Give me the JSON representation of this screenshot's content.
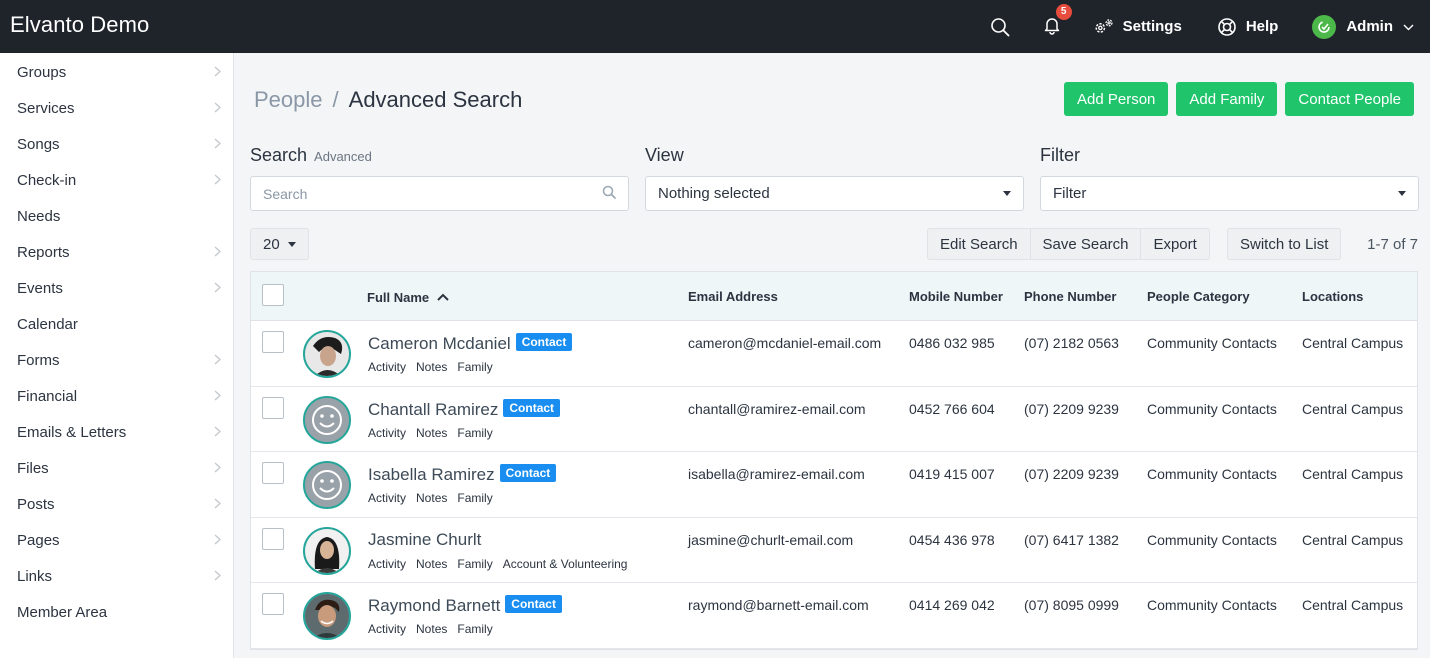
{
  "app": {
    "title": "Elvanto Demo"
  },
  "topbar": {
    "notifications_count": "5",
    "settings_label": "Settings",
    "help_label": "Help",
    "user_label": "Admin"
  },
  "sidebar": {
    "items": [
      {
        "label": "Groups",
        "has_children": true
      },
      {
        "label": "Services",
        "has_children": true
      },
      {
        "label": "Songs",
        "has_children": true
      },
      {
        "label": "Check-in",
        "has_children": true
      },
      {
        "label": "Needs",
        "has_children": false
      },
      {
        "label": "Reports",
        "has_children": true
      },
      {
        "label": "Events",
        "has_children": true
      },
      {
        "label": "Calendar",
        "has_children": false
      },
      {
        "label": "Forms",
        "has_children": true
      },
      {
        "label": "Financial",
        "has_children": true
      },
      {
        "label": "Emails & Letters",
        "has_children": true
      },
      {
        "label": "Files",
        "has_children": true
      },
      {
        "label": "Posts",
        "has_children": true
      },
      {
        "label": "Pages",
        "has_children": true
      },
      {
        "label": "Links",
        "has_children": true
      },
      {
        "label": "Member Area",
        "has_children": false
      }
    ]
  },
  "breadcrumb": {
    "parent": "People",
    "separator": "/",
    "current": "Advanced Search"
  },
  "actions": {
    "add_person": "Add Person",
    "add_family": "Add Family",
    "contact_people": "Contact People"
  },
  "search": {
    "label": "Search",
    "sublabel": "Advanced",
    "placeholder": "Search"
  },
  "view": {
    "label": "View",
    "selected": "Nothing selected"
  },
  "filter": {
    "label": "Filter",
    "selected": "Filter"
  },
  "toolbar": {
    "per_page": "20",
    "edit_search": "Edit Search",
    "save_search": "Save Search",
    "export": "Export",
    "switch_to_list": "Switch to List",
    "count": "1-7 of 7"
  },
  "table": {
    "headers": {
      "full_name": "Full Name",
      "email": "Email Address",
      "mobile": "Mobile Number",
      "phone": "Phone Number",
      "category": "People Category",
      "locations": "Locations"
    },
    "rows": [
      {
        "name": "Cameron Mcdaniel",
        "tag": "Contact",
        "links": [
          "Activity",
          "Notes",
          "Family"
        ],
        "email": "cameron@mcdaniel-email.com",
        "mobile": "0486 032 985",
        "phone": "(07) 2182 0563",
        "category": "Community Contacts",
        "location": "Central Campus",
        "avatar": "photo-1"
      },
      {
        "name": "Chantall Ramirez",
        "tag": "Contact",
        "links": [
          "Activity",
          "Notes",
          "Family"
        ],
        "email": "chantall@ramirez-email.com",
        "mobile": "0452 766 604",
        "phone": "(07) 2209 9239",
        "category": "Community Contacts",
        "location": "Central Campus",
        "avatar": "smiley"
      },
      {
        "name": "Isabella Ramirez",
        "tag": "Contact",
        "links": [
          "Activity",
          "Notes",
          "Family"
        ],
        "email": "isabella@ramirez-email.com",
        "mobile": "0419 415 007",
        "phone": "(07) 2209 9239",
        "category": "Community Contacts",
        "location": "Central Campus",
        "avatar": "smiley"
      },
      {
        "name": "Jasmine Churlt",
        "tag": "",
        "links": [
          "Activity",
          "Notes",
          "Family",
          "Account & Volunteering"
        ],
        "email": "jasmine@churlt-email.com",
        "mobile": "0454 436 978",
        "phone": "(07) 6417 1382",
        "category": "Community Contacts",
        "location": "Central Campus",
        "avatar": "photo-2"
      },
      {
        "name": "Raymond Barnett",
        "tag": "Contact",
        "links": [
          "Activity",
          "Notes",
          "Family"
        ],
        "email": "raymond@barnett-email.com",
        "mobile": "0414 269 042",
        "phone": "(07) 8095 0999",
        "category": "Community Contacts",
        "location": "Central Campus",
        "avatar": "photo-3"
      }
    ]
  }
}
